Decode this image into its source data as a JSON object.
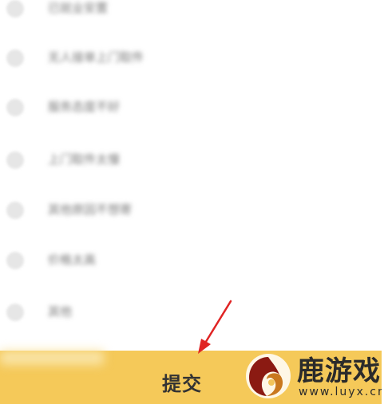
{
  "options": [
    {
      "label": "已就业安置"
    },
    {
      "label": "无人接单上门取件"
    },
    {
      "label": "服务态度不好"
    },
    {
      "label": "上门取件太慢"
    },
    {
      "label": "其他原因不想寄"
    },
    {
      "label": "价格太高"
    },
    {
      "label": "其他"
    }
  ],
  "submit": {
    "label": "提交"
  },
  "watermark": {
    "title": "鹿游戏",
    "url": "www.luyx.cn"
  },
  "colors": {
    "submit_bar": "#f5c959",
    "arrow": "#e02424",
    "radio": "#e6e6e6"
  }
}
